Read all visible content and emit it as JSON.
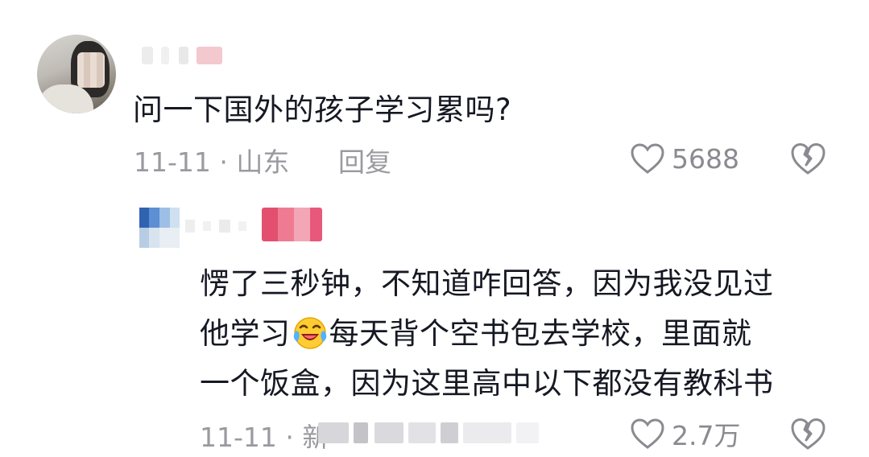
{
  "comment": {
    "text": "问一下国外的孩子学习累吗?",
    "time_location": "11-11 · 山东",
    "reply_label": "回复",
    "like_count": "5688",
    "icons": {
      "like": "heart-outline-icon",
      "dislike": "broken-heart-icon"
    }
  },
  "reply": {
    "lines": [
      "愣了三秒钟，不知道咋回答，因为我没见过",
      "他学习",
      "每天背个空书包去学校，里面就",
      "一个饭盒，因为这里高中以下都没有教科书"
    ],
    "emoji": "laughing-crying-emoji",
    "time": "11-11 · 新",
    "like_count": "2.7万"
  },
  "colors": {
    "text": "#161823",
    "meta": "#9a9aa0",
    "background": "#ffffff"
  }
}
